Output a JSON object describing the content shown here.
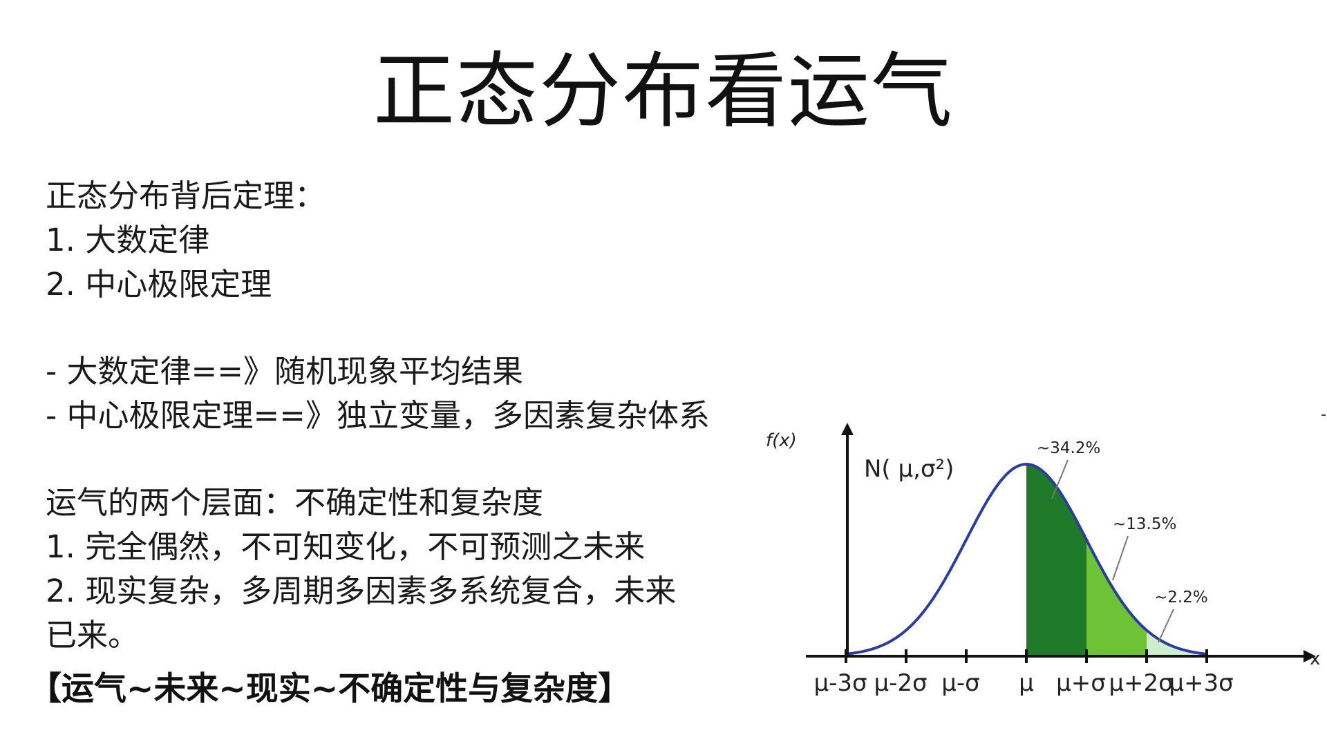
{
  "title": "正态分布看运气",
  "lines": [
    "正态分布背后定理：",
    "1. 大数定律",
    "2. 中心极限定理",
    "",
    "- 大数定律==》随机现象平均结果",
    "- 中心极限定理==》独立变量，多因素复杂体系",
    "",
    "运气的两个层面：不确定性和复杂度",
    "1. 完全偶然，不可知变化，不可预测之未来",
    "2. 现实复杂，多周期多因素多系统复合，未来",
    "已来。"
  ],
  "summary": "【运气~未来~现实~不确定性与复杂度】",
  "diagram": {
    "y_axis_label": "f(x)",
    "x_axis_label": "x",
    "formula": "N( μ,σ²)",
    "ticks": [
      "μ-3σ",
      "μ-2σ",
      "μ-σ",
      "μ",
      "μ+σ",
      "μ+2σ",
      "μ+3σ"
    ],
    "regions": [
      {
        "label": "~34.2%",
        "from_sigma": 0,
        "to_sigma": 1,
        "color": "#1f7a2a"
      },
      {
        "label": "~13.5%",
        "from_sigma": 1,
        "to_sigma": 2,
        "color": "#6dc235"
      },
      {
        "label": "~2.2%",
        "from_sigma": 2,
        "to_sigma": 3,
        "color": "#cfeccc"
      }
    ],
    "curve_color": "#2b3c9e",
    "axis_color": "#111111"
  }
}
